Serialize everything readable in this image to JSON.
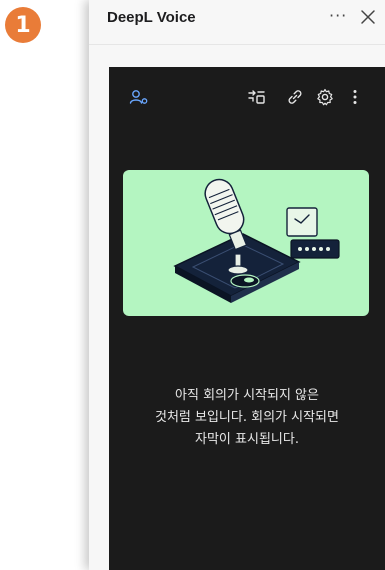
{
  "step_badge": "1",
  "window": {
    "title": "DeepL Voice",
    "more_label": "···"
  },
  "toolbar": {
    "icons": [
      "participants-icon",
      "switch-languages-icon",
      "link-icon",
      "settings-icon",
      "more-vertical-icon"
    ]
  },
  "colors": {
    "badge": "#e97c38",
    "accent": "#6aa7ff",
    "hero_background": "#b4f5c1",
    "panel_dark": "#1b1b1b"
  },
  "empty_state": {
    "illustration": "microphone-illustration",
    "lines": [
      "아직 회의가 시작되지 않은",
      "것처럼 보입니다. 회의가 시작되면",
      "자막이 표시됩니다."
    ]
  }
}
